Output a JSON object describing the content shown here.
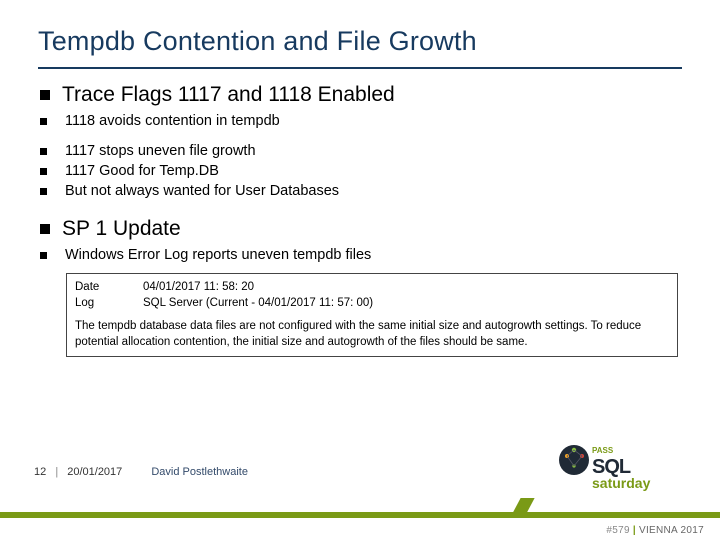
{
  "title": "Tempdb Contention and File Growth",
  "section1": {
    "heading": "Trace Flags 1117 and 1118 Enabled",
    "items": {
      "a": "1118 avoids contention in tempdb",
      "b": "1117 stops uneven file growth",
      "c": "1117 Good for Temp.DB",
      "d": "But not always wanted for User Databases"
    }
  },
  "section2": {
    "heading": "SP 1 Update",
    "items": {
      "a": "Windows Error Log reports uneven tempdb files"
    }
  },
  "logbox": {
    "dateKey": "Date",
    "dateVal": "04/01/2017 11: 58: 20",
    "logKey": "Log",
    "logVal": "SQL Server (Current - 04/01/2017 11: 57: 00)",
    "note": "The tempdb database data files are not configured with the same initial size and autogrowth settings. To reduce potential allocation contention, the initial size and autogrowth of the files should be same."
  },
  "footer": {
    "page": "12",
    "sep": "|",
    "date": "20/01/2017",
    "presenter": "David Postlethwaite"
  },
  "event": {
    "num": "#579",
    "city": "VIENNA 2017"
  },
  "logo": {
    "brand1": "PASS",
    "brand2": "SQL",
    "brand3": "saturday"
  }
}
